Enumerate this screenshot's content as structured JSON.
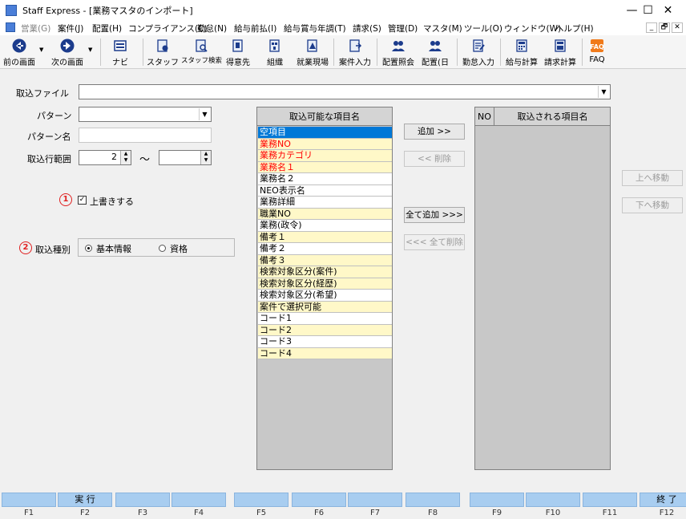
{
  "window": {
    "title": "Staff Express - [業務マスタのインポート]",
    "controls": [
      "—",
      "☐",
      "✕"
    ]
  },
  "menu": {
    "items": [
      "営業(G)",
      "案件(J)",
      "配置(H)",
      "コンプライアンス(C)",
      "勤怠(N)",
      "給与前払(I)",
      "給与賞与年調(T)",
      "請求(S)",
      "管理(D)",
      "マスタ(M)",
      "ツール(O)",
      "ウィンドウ(W)",
      "ヘルプ(H)"
    ],
    "mdi_controls": [
      "_",
      "🗗",
      "✕"
    ]
  },
  "toolbar": {
    "prev": "前の画面",
    "next": "次の画面",
    "items": [
      "ナビ",
      "スタッフ",
      "スタッフ検索",
      "得意先",
      "組織",
      "就業現場",
      "案件入力",
      "配置照会",
      "配置(日",
      "勤怠入力",
      "給与計算",
      "請求計算",
      "FAQ"
    ]
  },
  "form": {
    "file_label": "取込ファイル",
    "file_value": "",
    "pattern_label": "パターン",
    "pattern_value": "",
    "pattern_name_label": "パターン名",
    "pattern_name_value": "",
    "range_label": "取込行範囲",
    "range_from": "2",
    "range_sep": "～",
    "range_to": "",
    "marker1": "1",
    "overwrite_label": "上書きする",
    "overwrite_checked": true,
    "marker2": "2",
    "type_label": "取込種別",
    "type_options": [
      "基本情報",
      "資格"
    ],
    "type_selected": "基本情報"
  },
  "available": {
    "header": "取込可能な項目名",
    "items": [
      {
        "label": "空項目",
        "style": "selected"
      },
      {
        "label": "業務NO",
        "style": "red"
      },
      {
        "label": "業務カテゴリ",
        "style": "red"
      },
      {
        "label": "業務名１",
        "style": "red"
      },
      {
        "label": "業務名２",
        "style": "white"
      },
      {
        "label": "NEO表示名",
        "style": "white"
      },
      {
        "label": "業務詳細",
        "style": "white"
      },
      {
        "label": "職業NO",
        "style": "yellow"
      },
      {
        "label": "業務(政令)",
        "style": "white"
      },
      {
        "label": "備考１",
        "style": "yellow"
      },
      {
        "label": "備考２",
        "style": "white"
      },
      {
        "label": "備考３",
        "style": "yellow"
      },
      {
        "label": "検索対象区分(案件)",
        "style": "yellow"
      },
      {
        "label": "検索対象区分(経歴)",
        "style": "yellow"
      },
      {
        "label": "検索対象区分(希望)",
        "style": "white"
      },
      {
        "label": "案件で選択可能",
        "style": "yellow"
      },
      {
        "label": "コード1",
        "style": "white"
      },
      {
        "label": "コード2",
        "style": "yellow"
      },
      {
        "label": "コード3",
        "style": "white"
      },
      {
        "label": "コード4",
        "style": "yellow"
      }
    ]
  },
  "buttons": {
    "add": "追加 >>",
    "remove": "<< 削除",
    "add_all": "全て追加 >>>",
    "remove_all": "<<< 全て削除",
    "move_up": "上へ移動",
    "move_down": "下へ移動"
  },
  "imported": {
    "no_header": "NO",
    "header": "取込される項目名",
    "items": []
  },
  "fkeys": [
    {
      "label": "",
      "key": "F1"
    },
    {
      "label": "実 行",
      "key": "F2"
    },
    {
      "label": "",
      "key": "F3"
    },
    {
      "label": "",
      "key": "F4"
    },
    {
      "label": "",
      "key": "F5"
    },
    {
      "label": "",
      "key": "F6"
    },
    {
      "label": "",
      "key": "F7"
    },
    {
      "label": "",
      "key": "F8"
    },
    {
      "label": "",
      "key": "F9"
    },
    {
      "label": "",
      "key": "F10"
    },
    {
      "label": "",
      "key": "F11"
    },
    {
      "label": "終 了",
      "key": "F12"
    }
  ],
  "colors": {
    "selected_bg": "#0078d7",
    "yellow_row": "#fff8c8",
    "red_text": "#ff0000",
    "fkey_bg": "#a8cdf0"
  }
}
